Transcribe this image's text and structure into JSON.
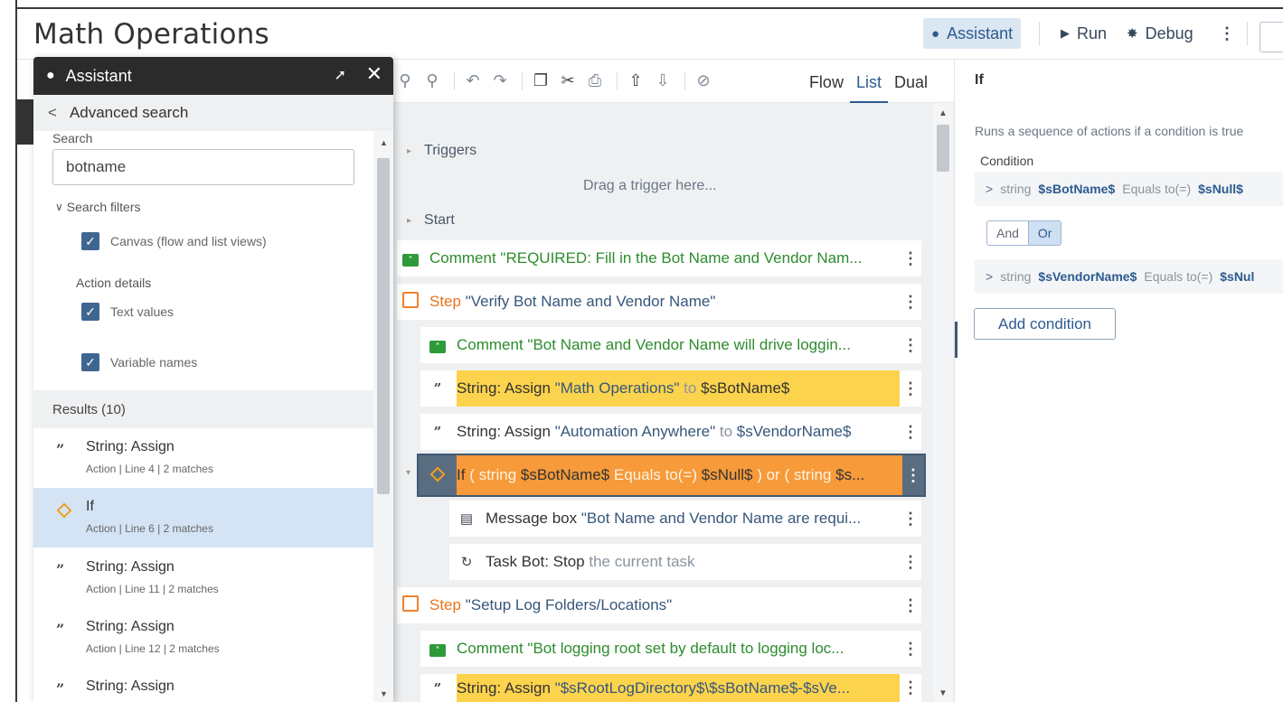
{
  "header": {
    "title": "Math Operations",
    "assistant_label": "Assistant",
    "run_label": "Run",
    "debug_label": "Debug"
  },
  "toolbar": {
    "views": [
      "Flow",
      "List",
      "Dual"
    ],
    "active_view": "List"
  },
  "canvas": {
    "triggers_label": "Triggers",
    "drag_hint": "Drag a trigger here...",
    "start_label": "Start",
    "rows": [
      {
        "kind": "comment",
        "prefix": "Comment",
        "text": "\"REQUIRED: Fill in the Bot Name and Vendor Nam..."
      },
      {
        "kind": "step",
        "prefix": "Step",
        "text": "\"Verify Bot Name and Vendor Name\""
      },
      {
        "kind": "comment",
        "prefix": "Comment",
        "text": "\"Bot Name and Vendor Name will drive loggin..."
      },
      {
        "kind": "string",
        "prefix": "String: Assign",
        "value": "\"Math Operations\"",
        "to": "to",
        "var": "$sBotName$"
      },
      {
        "kind": "string",
        "prefix": "String: Assign",
        "value": "\"Automation Anywhere\"",
        "to": "to",
        "var": "$sVendorName$"
      },
      {
        "kind": "if",
        "prefix": "If",
        "open": "( string",
        "var1": "$sBotName$",
        "op": "Equals to(=)",
        "var2": "$sNull$",
        "rest": ") or ( string",
        "tail": "$s..."
      },
      {
        "kind": "msg",
        "prefix": "Message box",
        "text": "\"Bot Name and Vendor Name are requi..."
      },
      {
        "kind": "stop",
        "prefix": "Task Bot: Stop",
        "text": "the current task"
      },
      {
        "kind": "step",
        "prefix": "Step",
        "text": "\"Setup Log Folders/Locations\""
      },
      {
        "kind": "comment",
        "prefix": "Comment",
        "text": "\"Bot logging root set by default to logging loc..."
      },
      {
        "kind": "string",
        "prefix": "String: Assign",
        "value": "\"$sRootLogDirectory$\\$sBotName$-$sVe..."
      }
    ]
  },
  "properties": {
    "title": "If",
    "description": "Runs a sequence of actions if a condition is true",
    "condition_label": "Condition",
    "conditions": [
      {
        "type": "string",
        "var": "$sBotName$",
        "op": "Equals to(=)",
        "value": "$sNull$"
      },
      {
        "type": "string",
        "var": "$sVendorName$",
        "op": "Equals to(=)",
        "value": "$sNul"
      }
    ],
    "and_label": "And",
    "or_label": "Or",
    "add_condition_label": "Add condition"
  },
  "assistant": {
    "title": "Assistant",
    "back_label": "Advanced search",
    "search_label": "Search",
    "search_value": "botname",
    "filters_label": "Search filters",
    "filter_canvas": "Canvas (flow and list views)",
    "action_details_label": "Action details",
    "filter_text": "Text values",
    "filter_vars": "Variable names",
    "results_label": "Results (10)",
    "results": [
      {
        "title": "String: Assign",
        "meta": "Action | Line 4 | 2 matches",
        "icon": "quote-icon"
      },
      {
        "title": "If",
        "meta": "Action | Line 6 | 2 matches",
        "icon": "diamond-icon"
      },
      {
        "title": "String: Assign",
        "meta": "Action | Line 11 | 2 matches",
        "icon": "quote-icon"
      },
      {
        "title": "String: Assign",
        "meta": "Action | Line 12 | 2 matches",
        "icon": "quote-icon"
      },
      {
        "title": "String: Assign",
        "meta": "",
        "icon": "quote-icon"
      }
    ]
  }
}
